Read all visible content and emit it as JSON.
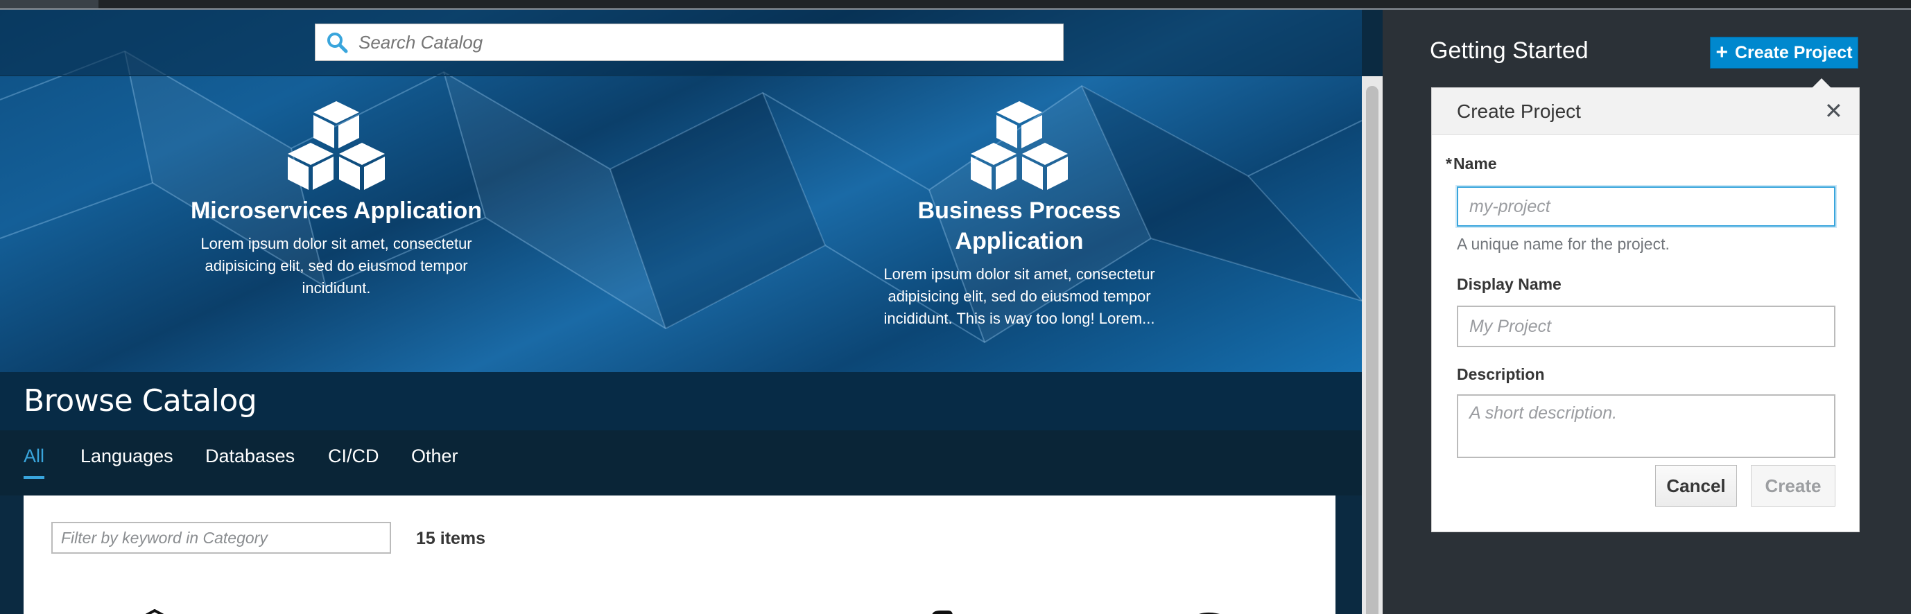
{
  "search": {
    "placeholder": "Search Catalog"
  },
  "features": [
    {
      "title": "Microservices Application",
      "description": "Lorem ipsum dolor sit amet, consectetur adipisicing elit, sed do eiusmod tempor incididunt."
    },
    {
      "title_line1": "Business Process",
      "title_line2": "Application",
      "description": "Lorem ipsum dolor sit amet, consectetur adipisicing elit, sed do eiusmod tempor incididunt. This is way too long! Lorem..."
    }
  ],
  "browse": {
    "title": "Browse Catalog",
    "tabs": [
      "All",
      "Languages",
      "Databases",
      "CI/CD",
      "Other"
    ],
    "active_tab": "All"
  },
  "filter": {
    "placeholder": "Filter by keyword in Category",
    "count": "15 items"
  },
  "side": {
    "title": "Getting Started",
    "create_button": "Create Project"
  },
  "popover": {
    "title": "Create Project",
    "name_label": "Name",
    "name_required_marker": "*",
    "name_placeholder": "my-project",
    "name_help": "A unique name for the project.",
    "display_label": "Display Name",
    "display_placeholder": "My Project",
    "description_label": "Description",
    "description_placeholder": "A short description.",
    "cancel": "Cancel",
    "create": "Create"
  },
  "colors": {
    "accent": "#39a5dc",
    "primary_button": "#0088ce",
    "side_bg": "#2b3137"
  },
  "icons": [
    "search-icon",
    "cubes-icon",
    "plus-icon",
    "close-icon"
  ]
}
